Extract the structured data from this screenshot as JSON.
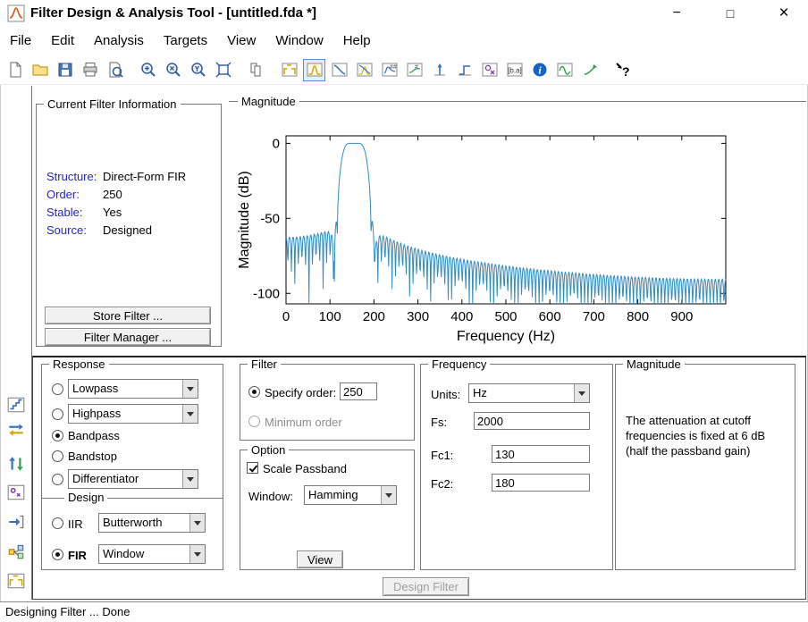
{
  "window": {
    "title": "Filter Design & Analysis Tool - [untitled.fda *]",
    "controls": {
      "minimize": "−",
      "maximize": "□",
      "close": "×"
    }
  },
  "menu": {
    "items": [
      "File",
      "Edit",
      "Analysis",
      "Targets",
      "View",
      "Window",
      "Help"
    ]
  },
  "toolbar": {
    "buttons": [
      {
        "name": "new-session",
        "sym": "page"
      },
      {
        "name": "open-session",
        "sym": "folder"
      },
      {
        "name": "save-session",
        "sym": "floppy"
      },
      {
        "name": "print",
        "sym": "printer"
      },
      {
        "name": "print-preview",
        "sym": "preview"
      },
      {
        "sep": true
      },
      {
        "name": "zoom-in",
        "sym": "zoomin"
      },
      {
        "name": "zoom-x",
        "sym": "zoomx"
      },
      {
        "name": "zoom-y",
        "sym": "zoomy"
      },
      {
        "name": "full-view",
        "sym": "fullview"
      },
      {
        "sep": true
      },
      {
        "name": "copy-figure",
        "sym": "copy"
      },
      {
        "sep": true
      },
      {
        "name": "filter-specifications",
        "sym": "spec"
      },
      {
        "name": "magnitude-response",
        "sym": "mag",
        "selected": true
      },
      {
        "name": "phase-response",
        "sym": "phase"
      },
      {
        "name": "magnitude-and-phase-responses",
        "sym": "magphase"
      },
      {
        "name": "group-delay-response",
        "sym": "gdelay"
      },
      {
        "name": "phase-delay-response",
        "sym": "pdelay"
      },
      {
        "name": "impulse-response",
        "sym": "impulse"
      },
      {
        "name": "step-response",
        "sym": "step"
      },
      {
        "name": "pole-zero-plot",
        "sym": "polezero"
      },
      {
        "name": "filter-coefficients",
        "sym": "coeffs"
      },
      {
        "name": "filter-information",
        "sym": "info"
      },
      {
        "name": "magnitude-response-estimate",
        "sym": "wave1"
      },
      {
        "name": "round-off-noise-spectrum",
        "sym": "wave2"
      },
      {
        "sep": true
      },
      {
        "name": "help",
        "sym": "help"
      }
    ]
  },
  "sidebar": {
    "buttons": [
      {
        "name": "set-quantization-parameters",
        "sym": "quant"
      },
      {
        "name": "transform-filter",
        "sym": "transform"
      },
      {
        "name": "create-multirate-filter",
        "sym": "multirate"
      },
      {
        "name": "pole-zero-editor",
        "sym": "pzedit"
      },
      {
        "name": "import-filter",
        "sym": "import"
      },
      {
        "name": "realize-model",
        "sym": "realize"
      },
      {
        "name": "design-filter",
        "sym": "spec"
      }
    ]
  },
  "current_filter_info": {
    "title": "Current Filter Information",
    "rows": [
      {
        "label": "Structure:",
        "value": "Direct-Form FIR"
      },
      {
        "label": "Order:",
        "value": "250"
      },
      {
        "label": "Stable:",
        "value": "Yes"
      },
      {
        "label": "Source:",
        "value": "Designed"
      }
    ],
    "store_button": "Store Filter ...",
    "manager_button": "Filter Manager ..."
  },
  "chart_data": {
    "type": "line",
    "panel_title": "Magnitude",
    "ylabel": "Magnitude (dB)",
    "xlabel": "Frequency (Hz)",
    "xlim": [
      0,
      1000
    ],
    "ylim": [
      -107,
      5
    ],
    "xticks": [
      0,
      100,
      200,
      300,
      400,
      500,
      600,
      700,
      800,
      900
    ],
    "yticks": [
      0,
      -50,
      -100
    ],
    "line_color": "#318CC2",
    "grid": false,
    "filter": {
      "response": "bandpass",
      "design_method": "FIR window",
      "window": "Hamming",
      "order": 250,
      "fs": 2000,
      "fc1": 130,
      "fc2": 180,
      "scale_passband": true
    }
  },
  "response_panel": {
    "title": "Response",
    "options": [
      {
        "name": "lowpass",
        "label": "Lowpass",
        "combo": "Lowpass",
        "selected": false
      },
      {
        "name": "highpass",
        "label": "Highpass",
        "combo": "Highpass",
        "selected": false
      },
      {
        "name": "bandpass",
        "label": "Bandpass",
        "selected": true
      },
      {
        "name": "bandstop",
        "label": "Bandstop",
        "selected": false
      },
      {
        "name": "differentiator",
        "label": "Differentiator",
        "combo": "Differentiator",
        "selected": false
      }
    ],
    "design_title": "Design",
    "iir": {
      "label": "IIR",
      "combo": "Butterworth",
      "selected": false
    },
    "fir": {
      "label": "FIR",
      "combo": "Window",
      "selected": true
    }
  },
  "filter_panel": {
    "title": "Filter",
    "specify_label": "Specify order:",
    "specify_value": "250",
    "minimum_label": "Minimum order"
  },
  "option_panel": {
    "title": "Option",
    "scale_label": "Scale Passband",
    "window_label": "Window:",
    "window_value": "Hamming",
    "view_button": "View"
  },
  "frequency_panel": {
    "title": "Frequency",
    "units_label": "Units:",
    "units_value": "Hz",
    "fs_label": "Fs:",
    "fs_value": "2000",
    "fc1_label": "Fc1:",
    "fc1_value": "130",
    "fc2_label": "Fc2:",
    "fc2_value": "180"
  },
  "magnitude_panel": {
    "title": "Magnitude",
    "note_lines": [
      "The attenuation at cutoff",
      "frequencies is fixed at 6 dB",
      "(half the passband gain)"
    ]
  },
  "design_filter_button": "Design Filter",
  "status_bar": "Designing Filter ... Done"
}
